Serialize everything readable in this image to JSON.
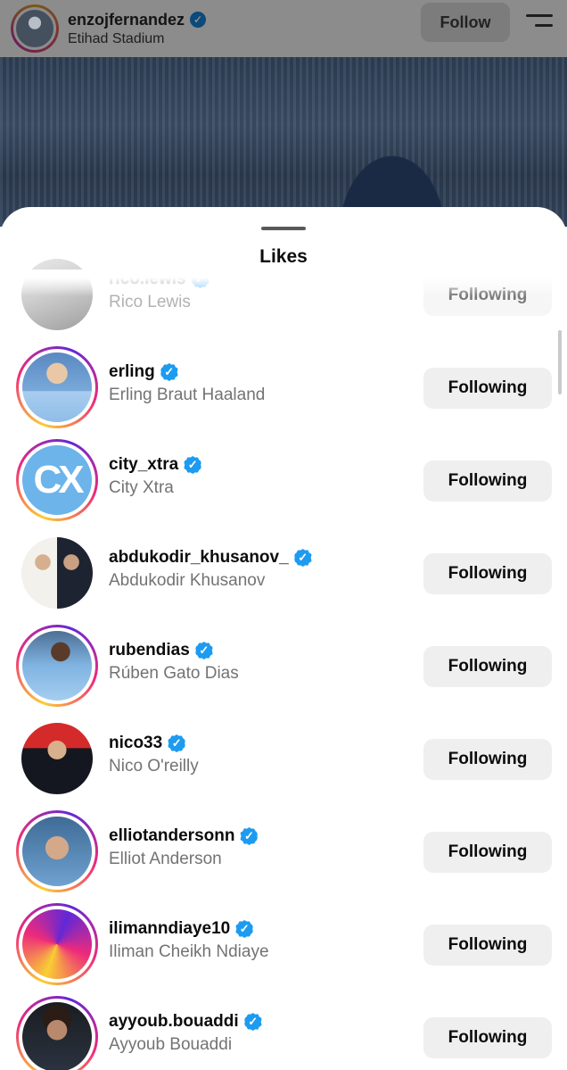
{
  "post": {
    "username": "enzojfernandez",
    "location": "Etihad Stadium",
    "follow_label": "Follow"
  },
  "sheet": {
    "title": "Likes",
    "button_label": "Following"
  },
  "likes": [
    {
      "username": "rico.lewis",
      "full_name": "Rico Lewis",
      "verified": true,
      "story_ring": false,
      "avatar": "rico-lewis-photo"
    },
    {
      "username": "erling",
      "full_name": "Erling Braut Haaland",
      "verified": true,
      "story_ring": true,
      "avatar": "erling-photo"
    },
    {
      "username": "city_xtra",
      "full_name": "City Xtra",
      "verified": true,
      "story_ring": true,
      "avatar": "cx-logo",
      "logo_text": "CX"
    },
    {
      "username": "abdukodir_khusanov_",
      "full_name": "Abdukodir Khusanov",
      "verified": true,
      "story_ring": false,
      "avatar": "khusanov-photo"
    },
    {
      "username": "rubendias",
      "full_name": "Rúben Gato Dias",
      "verified": true,
      "story_ring": true,
      "avatar": "ruben-photo"
    },
    {
      "username": "nico33",
      "full_name": "Nico O'reilly",
      "verified": true,
      "story_ring": false,
      "avatar": "nico-photo"
    },
    {
      "username": "elliotandersonn",
      "full_name": "Elliot Anderson",
      "verified": true,
      "story_ring": true,
      "avatar": "elliot-photo"
    },
    {
      "username": "ilimanndiaye10",
      "full_name": "Iliman Cheikh Ndiaye",
      "verified": true,
      "story_ring": true,
      "avatar": "iliman-photo"
    },
    {
      "username": "ayyoub.bouaddi",
      "full_name": "Ayyoub Bouaddi",
      "verified": true,
      "story_ring": true,
      "avatar": "ayyoub-photo"
    }
  ],
  "colors": {
    "verified_badge": "#1d9bf0",
    "button_bg": "#efefef",
    "secondary_text": "#737373"
  }
}
